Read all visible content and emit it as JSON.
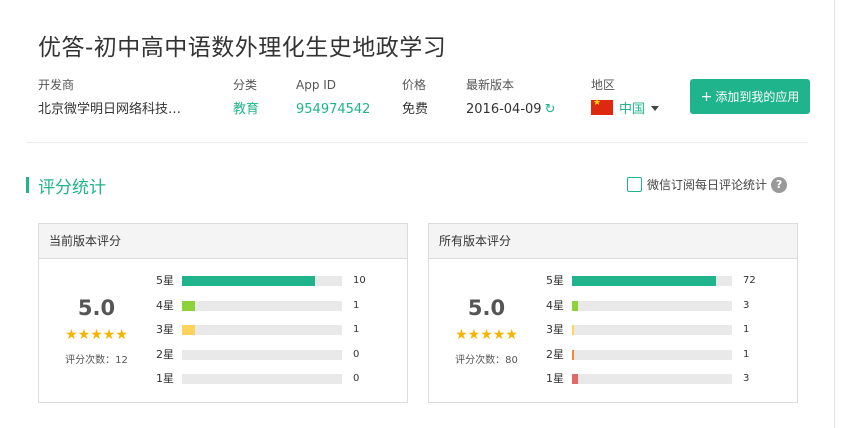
{
  "app": {
    "title": "优答-初中高中语数外理化生史地政学习"
  },
  "meta": {
    "developer_label": "开发商",
    "developer_value": "北京微学明日网络科技…",
    "category_label": "分类",
    "category_value": "教育",
    "appid_label": "App ID",
    "appid_value": "954974542",
    "price_label": "价格",
    "price_value": "免费",
    "version_label": "最新版本",
    "version_value": "2016-04-09",
    "region_label": "地区",
    "region_value": "中国"
  },
  "actions": {
    "add_label": "添加到我的应用",
    "add_icon": "plus-icon"
  },
  "section": {
    "title": "评分统计",
    "wechat_label": "微信订阅每日评论统计",
    "help_icon": "question-circle-icon"
  },
  "colors": {
    "accent": "#20b48c",
    "star": "#f5b400",
    "bar_5": "#20b48c",
    "bar_4": "#8dd23a",
    "bar_3": "#ffd25e",
    "bar_2": "#f0883e",
    "bar_1": "#e06a6a"
  },
  "ratings": {
    "current": {
      "header": "当前版本评分",
      "score": "5.0",
      "stars": 5,
      "count_label": "评分次数：12",
      "rows": [
        {
          "label": "5星",
          "count": 10,
          "fraction": 0.83
        },
        {
          "label": "4星",
          "count": 1,
          "fraction": 0.08
        },
        {
          "label": "3星",
          "count": 1,
          "fraction": 0.08
        },
        {
          "label": "2星",
          "count": 0,
          "fraction": 0
        },
        {
          "label": "1星",
          "count": 0,
          "fraction": 0
        }
      ]
    },
    "all": {
      "header": "所有版本评分",
      "score": "5.0",
      "stars": 5,
      "count_label": "评分次数：80",
      "rows": [
        {
          "label": "5星",
          "count": 72,
          "fraction": 0.9
        },
        {
          "label": "4星",
          "count": 3,
          "fraction": 0.04
        },
        {
          "label": "3星",
          "count": 1,
          "fraction": 0.0125
        },
        {
          "label": "2星",
          "count": 1,
          "fraction": 0.0125
        },
        {
          "label": "1星",
          "count": 3,
          "fraction": 0.04
        }
      ]
    }
  }
}
